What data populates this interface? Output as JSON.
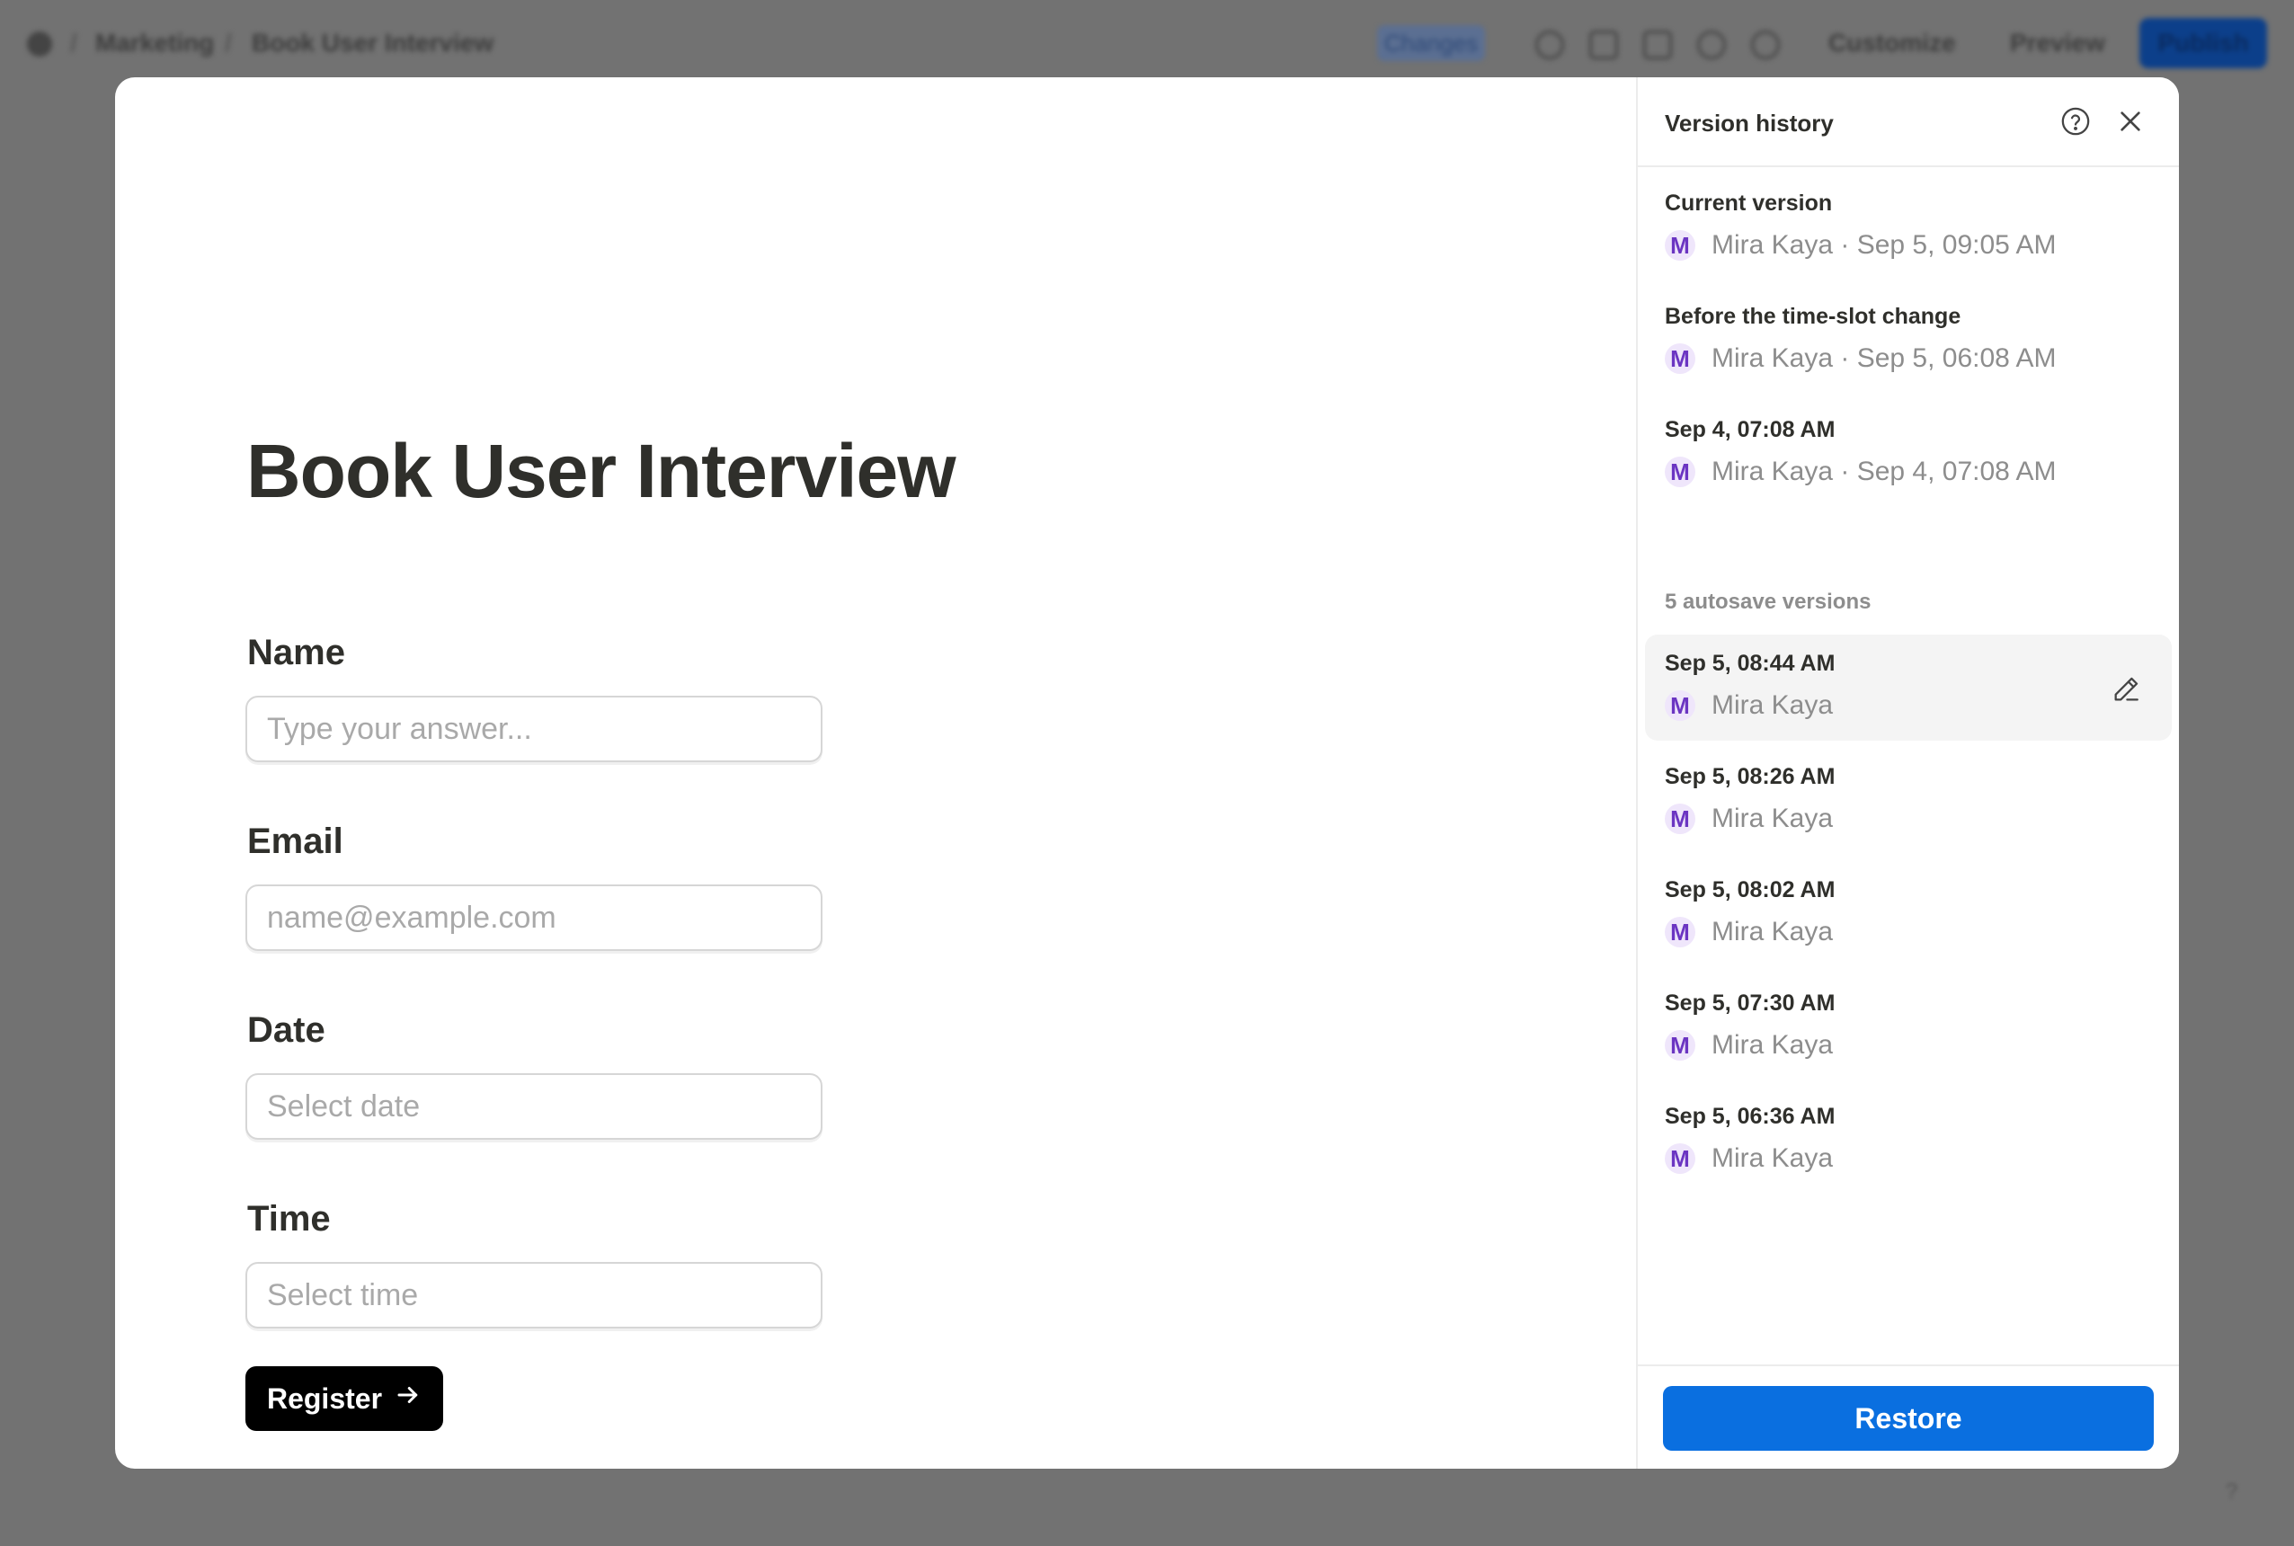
{
  "background": {
    "breadcrumb": {
      "workspace": "Marketing",
      "page": "Book User Interview"
    },
    "toolbar": {
      "changes": "Changes",
      "customize": "Customize",
      "preview": "Preview",
      "publish": "Publish"
    },
    "corner_label": "?"
  },
  "form": {
    "title": "Book User Interview",
    "fields": [
      {
        "label": "Name",
        "placeholder": "Type your answer..."
      },
      {
        "label": "Email",
        "placeholder": "name@example.com"
      },
      {
        "label": "Date",
        "placeholder": "Select date"
      },
      {
        "label": "Time",
        "placeholder": "Select time"
      }
    ],
    "submit_label": "Register"
  },
  "version_history": {
    "title": "Version history",
    "named_versions": [
      {
        "title": "Current version",
        "avatar": "M",
        "meta": "Mira Kaya · Sep 5, 09:05 AM"
      },
      {
        "title": "Before the time-slot change",
        "avatar": "M",
        "meta": "Mira Kaya · Sep 5, 06:08 AM"
      },
      {
        "title": "Sep 4, 07:08 AM",
        "avatar": "M",
        "meta": "Mira Kaya · Sep 4, 07:08 AM"
      }
    ],
    "autosave_label": "5 autosave versions",
    "autosave_versions": [
      {
        "title": "Sep 5, 08:44 AM",
        "avatar": "M",
        "meta": "Mira Kaya"
      },
      {
        "title": "Sep 5, 08:26 AM",
        "avatar": "M",
        "meta": "Mira Kaya"
      },
      {
        "title": "Sep 5, 08:02 AM",
        "avatar": "M",
        "meta": "Mira Kaya"
      },
      {
        "title": "Sep 5, 07:30 AM",
        "avatar": "M",
        "meta": "Mira Kaya"
      },
      {
        "title": "Sep 5, 06:36 AM",
        "avatar": "M",
        "meta": "Mira Kaya"
      }
    ],
    "selected_autosave_index": 0,
    "restore_label": "Restore"
  },
  "colors": {
    "accent": "#0a6fe0",
    "avatar_text": "#6b35c2",
    "avatar_bg": "#efe6fb",
    "overlay": "#727272"
  },
  "icons": {
    "help": "help-circle-icon",
    "close": "close-icon",
    "edit": "pencil-icon",
    "submit_arrow": "arrow-right-icon"
  }
}
